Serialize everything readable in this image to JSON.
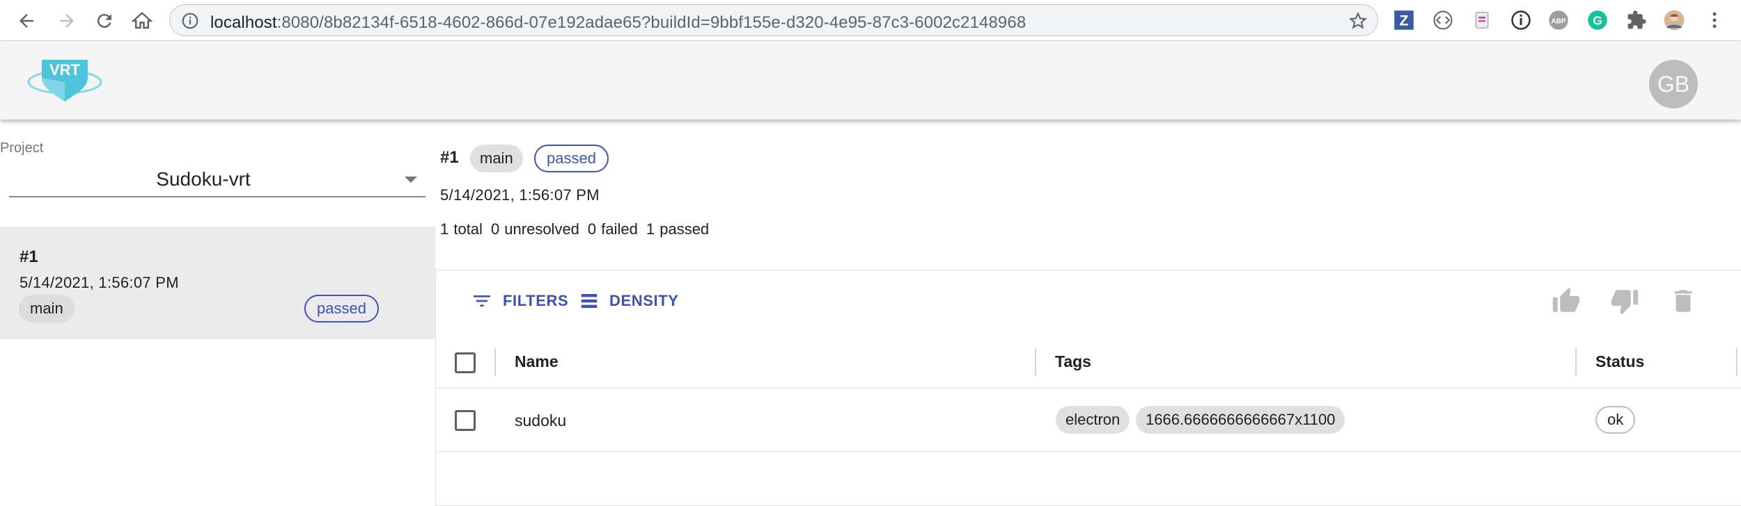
{
  "browser": {
    "url_host": "localhost",
    "url_rest": ":8080/8b82134f-6518-4602-866d-07e192adae65?buildId=9bbf155e-d320-4e95-87c3-6002c2148968",
    "extensions": [
      "zotero-icon",
      "code-icon",
      "clipboard-icon",
      "info-icon",
      "adblock-icon",
      "grammarly-icon",
      "puzzle-icon",
      "profile-icon",
      "menu-icon"
    ],
    "adblock_label": "ABP",
    "zotero_label": "Z",
    "grammarly_label": "G"
  },
  "header": {
    "logo_text": "VRT",
    "avatar_initials": "GB"
  },
  "sidebar": {
    "project_label": "Project",
    "project_value": "Sudoku-vrt",
    "build": {
      "number": "#1",
      "date": "5/14/2021, 1:56:07 PM",
      "branch": "main",
      "status": "passed"
    }
  },
  "build_info": {
    "number": "#1",
    "branch": "main",
    "status": "passed",
    "date": "5/14/2021, 1:56:07 PM",
    "stats": {
      "total": "1 total",
      "unresolved": "0 unresolved",
      "failed": "0 failed",
      "passed": "1 passed"
    }
  },
  "grid": {
    "toolbar": {
      "filters_label": "FILTERS",
      "density_label": "DENSITY"
    },
    "columns": {
      "name": "Name",
      "tags": "Tags",
      "status": "Status"
    },
    "rows": [
      {
        "name": "sudoku",
        "tags": [
          "electron",
          "1666.6666666666667x1100"
        ],
        "status": "ok"
      }
    ]
  },
  "colors": {
    "primary": "#3f51b5",
    "logo": "#4fc3d9",
    "header_bg": "#f5f5f5",
    "selected_build_bg": "#ebebeb"
  }
}
